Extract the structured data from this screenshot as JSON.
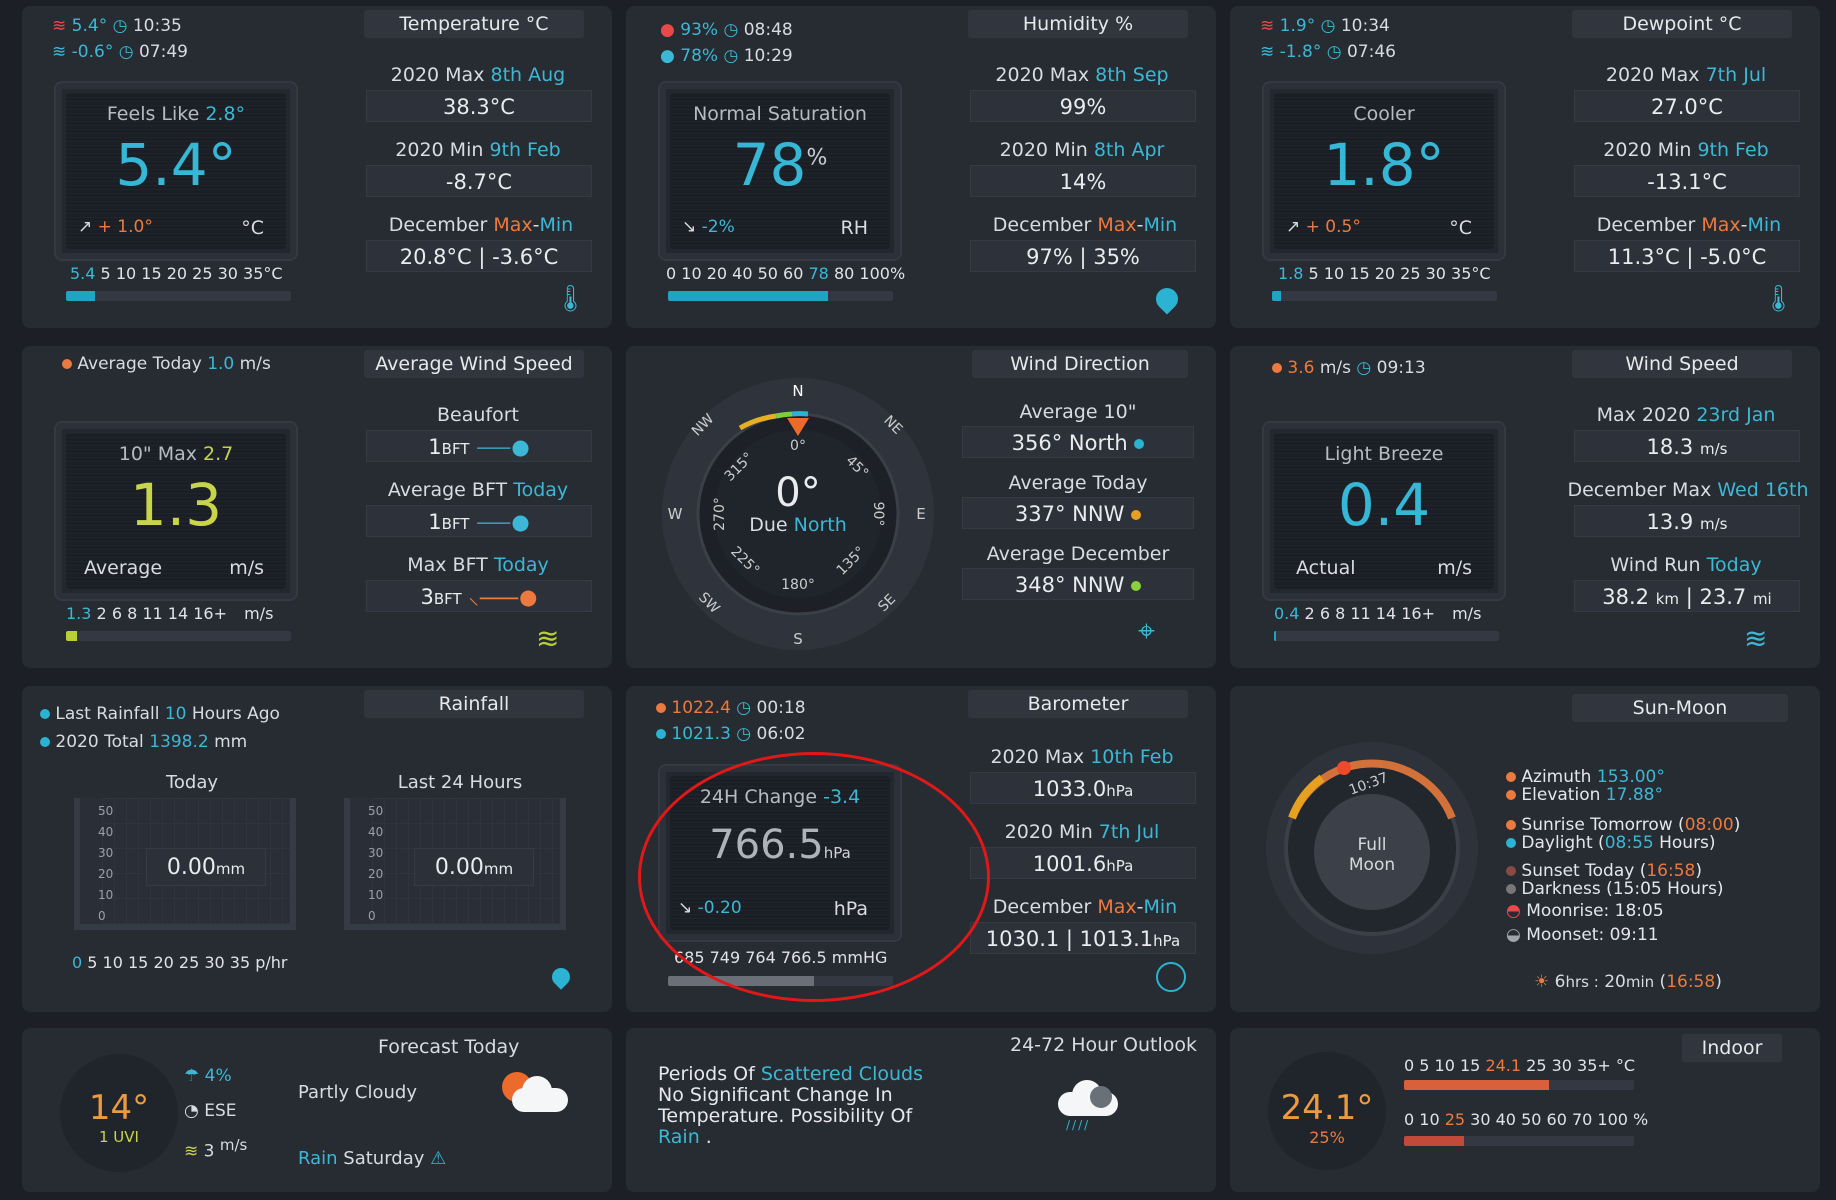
{
  "temperature": {
    "tab": "Temperature °C",
    "hi_val": "5.4°",
    "hi_time": "10:35",
    "lo_val": "-0.6°",
    "lo_time": "07:49",
    "feels_label": "Feels Like",
    "feels_val": "2.8°",
    "main": "5.4°",
    "trend": "+ 1.0°",
    "unit": "°C",
    "scale_cur": "5.4",
    "scale_rest": "5 10 15 20 25 30 35°C",
    "level": 0.13,
    "max_label": "2020 Max",
    "max_date": "8th Aug",
    "max_val": "38.3°C",
    "min_label": "2020 Min",
    "min_date": "9th Feb",
    "min_val": "-8.7°C",
    "month_label": "December",
    "month_max": "Max",
    "month_dash": "-",
    "month_min": "Min",
    "month_val": "20.8°C | -3.6°C"
  },
  "humidity": {
    "tab": "Humidity %",
    "hi_val": "93%",
    "hi_time": "08:48",
    "lo_val": "78%",
    "lo_time": "10:29",
    "status": "Normal Saturation",
    "main": "78",
    "pct": "%",
    "trend": "-2%",
    "unit": "RH",
    "scale_a": "0 10 20 40 50 60",
    "scale_cur": "78",
    "scale_b": "80 100%",
    "level": 0.71,
    "max_label": "2020 Max",
    "max_date": "8th Sep",
    "max_val": "99%",
    "min_label": "2020 Min",
    "min_date": "8th Apr",
    "min_val": "14%",
    "month_label": "December",
    "month_max": "Max",
    "month_dash": "-",
    "month_min": "Min",
    "month_val": "97% | 35%"
  },
  "dewpoint": {
    "tab": "Dewpoint °C",
    "hi_val": "1.9°",
    "hi_time": "10:34",
    "lo_val": "-1.8°",
    "lo_time": "07:46",
    "status": "Cooler",
    "main": "1.8°",
    "trend": "+ 0.5°",
    "unit": "°C",
    "scale_cur": "1.8",
    "scale_rest": "5 10 15 20 25 30 35°C",
    "level": 0.04,
    "max_label": "2020 Max",
    "max_date": "7th Jul",
    "max_val": "27.0°C",
    "min_label": "2020 Min",
    "min_date": "9th Feb",
    "min_val": "-13.1°C",
    "month_label": "December",
    "month_max": "Max",
    "month_dash": "-",
    "month_min": "Min",
    "month_val": "11.3°C | -5.0°C"
  },
  "avg_wind": {
    "tab": "Average Wind Speed",
    "avg_label": "Average Today",
    "avg_val": "1.0",
    "avg_unit": "m/s",
    "max_label": "10\" Max",
    "max_val": "2.7",
    "main": "1.3",
    "sub": "Average",
    "unit": "m/s",
    "scale_cur": "1.3",
    "scale_rest": "2 6 8 11 14 16+",
    "scale_unit": "m/s",
    "level": 0.05,
    "beaufort_label": "Beaufort",
    "beaufort_val": "1",
    "bft": "BFT",
    "avg_bft_label": "Average BFT",
    "avg_bft_when": "Today",
    "avg_bft_val": "1",
    "max_bft_label": "Max BFT",
    "max_bft_when": "Today",
    "max_bft_val": "3"
  },
  "wind_dir": {
    "tab": "Wind Direction",
    "n": "N",
    "ne": "NE",
    "e": "E",
    "se": "SE",
    "s": "S",
    "sw": "SW",
    "w": "W",
    "nw": "NW",
    "d0": "0°",
    "d45": "45°",
    "d90": "90°",
    "d135": "135°",
    "d180": "180°",
    "d225": "225°",
    "d270": "270°",
    "d315": "315°",
    "main": "0°",
    "due": "Due",
    "due_dir": "North",
    "heading_deg": 0,
    "avg10_label": "Average 10\"",
    "avg10_val": "356°  North",
    "avgtoday_label": "Average Today",
    "avgtoday_val": "337°  NNW",
    "avgdec_label": "Average December",
    "avgdec_val": "348°  NNW"
  },
  "wind_speed": {
    "tab": "Wind Speed",
    "hi_val": "3.6",
    "hi_unit": "m/s",
    "hi_time": "09:13",
    "status": "Light Breeze",
    "main": "0.4",
    "sub": "Actual",
    "unit": "m/s",
    "scale_cur": "0.4",
    "scale_rest": "2 6 8 11 14 16+",
    "scale_unit": "m/s",
    "level": 0.01,
    "max_label": "Max 2020",
    "max_date": "23rd Jan",
    "max_val": "18.3",
    "max_unit": "m/s",
    "dec_label": "December Max",
    "dec_date": "Wed 16th",
    "dec_val": "13.9",
    "dec_unit": "m/s",
    "run_label": "Wind Run",
    "run_when": "Today",
    "run_km": "38.2",
    "run_km_u": "km",
    "run_sep": "|",
    "run_mi": "23.7",
    "run_mi_u": "mi"
  },
  "rain": {
    "tab": "Rainfall",
    "last_label": "Last Rainfall",
    "last_val": "10",
    "last_unit": "Hours Ago",
    "total_label": "2020 Total",
    "total_val": "1398.2",
    "total_unit": "mm",
    "today_label": "Today",
    "today_val": "0.00",
    "today_unit": "mm",
    "l24_label": "Last 24 Hours",
    "l24_val": "0.00",
    "l24_unit": "mm",
    "ticks": [
      "50",
      "40",
      "30",
      "20",
      "10",
      "0"
    ],
    "scale_cur": "0",
    "scale_rest": "5 10 15 20 25 30 35 p/hr"
  },
  "baro": {
    "tab": "Barometer",
    "hi_val": "1022.4",
    "hi_time": "00:18",
    "lo_val": "1021.3",
    "lo_time": "06:02",
    "change_label": "24H Change",
    "change_val": "-3.4",
    "main": "766.5",
    "main_unit": "hPa",
    "trend": "-0.20",
    "unit": "hPa",
    "scale": "685 749 764 766.5 mmHG",
    "level": 0.65,
    "max_label": "2020 Max",
    "max_date": "10th Feb",
    "max_val": "1033.0",
    "max_unit": "hPa",
    "min_label": "2020 Min",
    "min_date": "7th Jul",
    "min_val": "1001.6",
    "min_unit": "hPa",
    "month_label": "December",
    "month_max": "Max",
    "month_dash": "-",
    "month_min": "Min",
    "month_val": "1030.1 | 1013.1",
    "month_unit": "hPa"
  },
  "sun": {
    "tab": "Sun-Moon",
    "time": "10:37",
    "moon_1": "Full",
    "moon_2": "Moon",
    "az_label": "Azimuth",
    "az_val": "153.00°",
    "el_label": "Elevation",
    "el_val": "17.88°",
    "rise_label": "Sunrise Tomorrow (",
    "rise_val": "08:00",
    "rise_end": ")",
    "day_label": "Daylight (",
    "day_val": "08:55",
    "day_end": "Hours)",
    "set_label": "Sunset Today (",
    "set_val": "16:58",
    "set_end": ")",
    "dark_label": "Darkness (15:05 Hours)",
    "moonrise": "Moonrise: 18:05",
    "moonset": "Moonset: 09:11",
    "left_h": "6",
    "left_hu": "hrs :",
    "left_m": "20",
    "left_mu": "min",
    "left_t": "16:58"
  },
  "forecast": {
    "tab": "Forecast Today",
    "temp": "14°",
    "uvi": "1 UVI",
    "rain_pct": "4%",
    "wind_dir": "ESE",
    "wind_val": "3",
    "wind_unit": "m/s",
    "cond": "Partly Cloudy",
    "rain_word": "Rain",
    "rain_day": "Saturday"
  },
  "outlook": {
    "tab": "24-72 Hour Outlook",
    "t1": "Periods Of ",
    "t1b": "Scattered Clouds",
    ".": ".",
    "t2": "No Significant Change In",
    "t3": "Temperature. Possibility Of",
    "t4": "Rain",
    " .": " ."
  },
  "indoor": {
    "tab": "Indoor",
    "temp": "24.1°",
    "hum": "25%",
    "t_scale_a": "0 5 10 15",
    "t_scale_cur": "24.1",
    "t_scale_b": "25 30 35+ °C",
    "t_level": 0.63,
    "h_scale_a": "0 10",
    "h_scale_cur": "25",
    "h_scale_b": "30 40 50 60 70 100 %",
    "h_level": 0.26
  }
}
